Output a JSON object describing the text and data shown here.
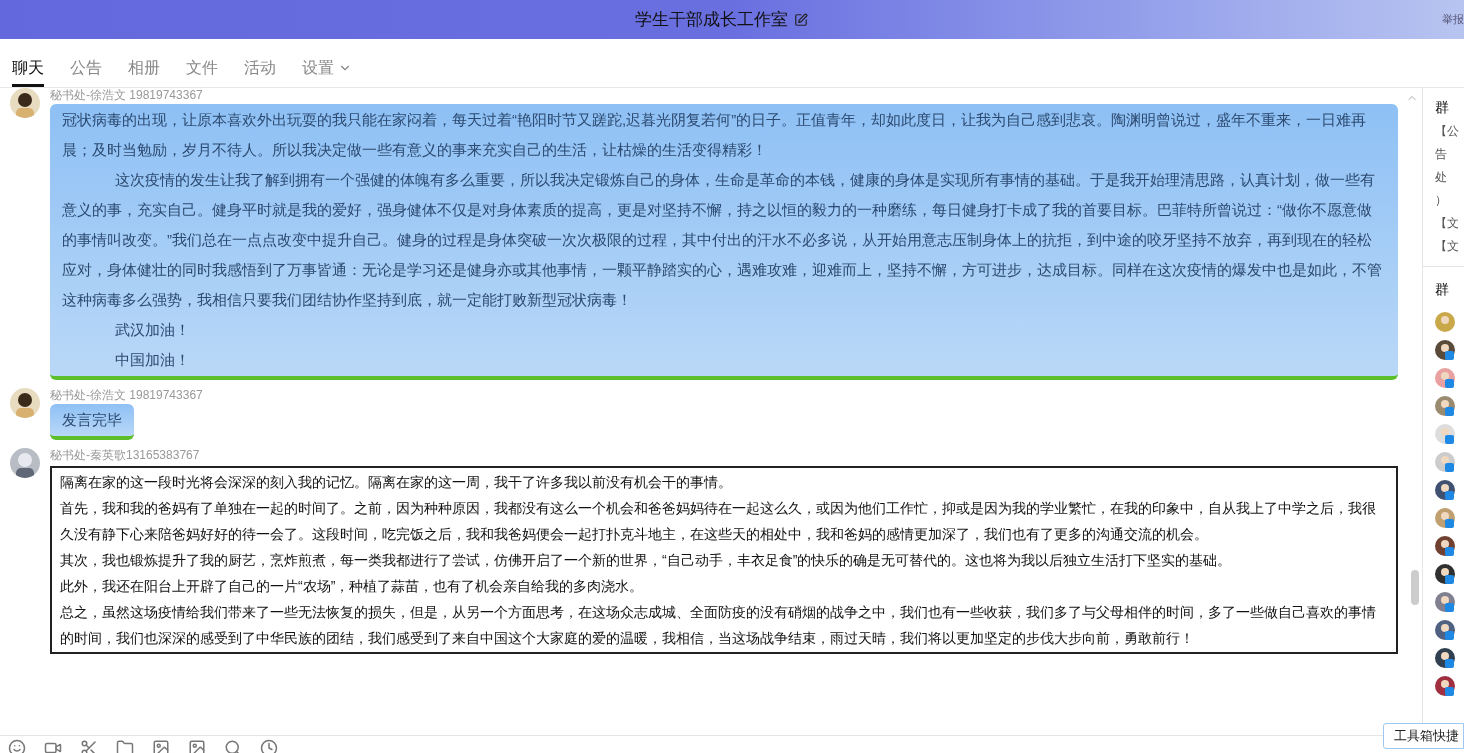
{
  "window": {
    "title": "学生干部成长工作室",
    "corner_link": "举报"
  },
  "tabs": [
    {
      "label": "聊天",
      "selected": true,
      "dropdown": false
    },
    {
      "label": "公告",
      "selected": false,
      "dropdown": false
    },
    {
      "label": "相册",
      "selected": false,
      "dropdown": false
    },
    {
      "label": "文件",
      "selected": false,
      "dropdown": false
    },
    {
      "label": "活动",
      "selected": false,
      "dropdown": false
    },
    {
      "label": "设置",
      "selected": false,
      "dropdown": true
    }
  ],
  "messages": [
    {
      "sender": "秘书处-徐浩文 19819743367",
      "kind": "sky",
      "paragraphs": [
        {
          "text": "冠状病毒的出现，让原本喜欢外出玩耍的我只能在家闷着，每天过着“艳阳时节又蹉跎,迟暮光阴复若何”的日子。正值青年，却如此度日，让我为自己感到悲哀。陶渊明曾说过，盛年不重来，一日难再晨；及时当勉励，岁月不待人。所以我决定做一些有意义的事来充实自己的生活，让枯燥的生活变得精彩！",
          "indent": false
        },
        {
          "text": "这次疫情的发生让我了解到拥有一个强健的体魄有多么重要，所以我决定锻炼自己的身体，生命是革命的本钱，健康的身体是实现所有事情的基础。于是我开始理清思路，认真计划，做一些有意义的事，充实自己。健身平时就是我的爱好，强身健体不仅是对身体素质的提高，更是对坚持不懈，持之以恒的毅力的一种磨练，每日健身打卡成了我的首要目标。巴菲特所曾说过：“做你不愿意做的事情叫改变。”我们总在一点点改变中提升自己。健身的过程是身体突破一次次极限的过程，其中付出的汗水不必多说，从开始用意志压制身体上的抗拒，到中途的咬牙坚持不放弃，再到现在的轻松应对，身体健壮的同时我感悟到了万事皆通：无论是学习还是健身亦或其他事情，一颗平静踏实的心，遇难攻难，迎难而上，坚持不懈，方可进步，达成目标。同样在这次疫情的爆发中也是如此，不管这种病毒多么强势，我相信只要我们团结协作坚持到底，就一定能打败新型冠状病毒！",
          "indent": true
        },
        {
          "text": "武汉加油！",
          "indent": true
        },
        {
          "text": "中国加油！",
          "indent": true
        }
      ]
    },
    {
      "sender": "秘书处-徐浩文 19819743367",
      "kind": "sky",
      "paragraphs": [
        {
          "text": "发言完毕",
          "indent": false
        }
      ]
    },
    {
      "sender": "秘书处-秦英歌13165383767",
      "kind": "sketch",
      "paragraphs": [
        {
          "text": "隔离在家的这一段时光将会深深的刻入我的记忆。隔离在家的这一周，我干了许多我以前没有机会干的事情。",
          "indent": false
        },
        {
          "text": "首先，我和我的爸妈有了单独在一起的时间了。之前，因为种种原因，我都没有这么一个机会和爸爸妈妈待在一起这么久，或因为他们工作忙，抑或是因为我的学业繁忙，在我的印象中，自从我上了中学之后，我很久没有静下心来陪爸妈好好的待一会了。这段时间，吃完饭之后，我和我爸妈便会一起打扑克斗地主，在这些天的相处中，我和爸妈的感情更加深了，我们也有了更多的沟通交流的机会。",
          "indent": false
        },
        {
          "text": "其次，我也锻炼提升了我的厨艺，烹炸煎煮，每一类我都进行了尝试，仿佛开启了一个新的世界，“自己动手，丰衣足食”的快乐的确是无可替代的。这也将为我以后独立生活打下坚实的基础。",
          "indent": false
        },
        {
          "text": "此外，我还在阳台上开辟了自己的一片“农场”，种植了蒜苗，也有了机会亲自给我的多肉浇水。",
          "indent": false
        },
        {
          "text": "总之，虽然这场疫情给我们带来了一些无法恢复的损失，但是，从另一个方面思考，在这场众志成城、全面防疫的没有硝烟的战争之中，我们也有一些收获，我们多了与父母相伴的时间，多了一些做自己喜欢的事情的时间，我们也深深的感受到了中华民族的团结，我们感受到了来自中国这个大家庭的爱的温暖，我相信，当这场战争结束，雨过天晴，我们将以更加坚定的步伐大步向前，勇敢前行！",
          "indent": false
        }
      ]
    }
  ],
  "side_panel": {
    "notice_title": "群",
    "notice_lines": [
      "【公",
      "告",
      "处",
      "）",
      "【文",
      "【文"
    ],
    "members_title": "群"
  },
  "tooltip": "工具箱快捷"
}
